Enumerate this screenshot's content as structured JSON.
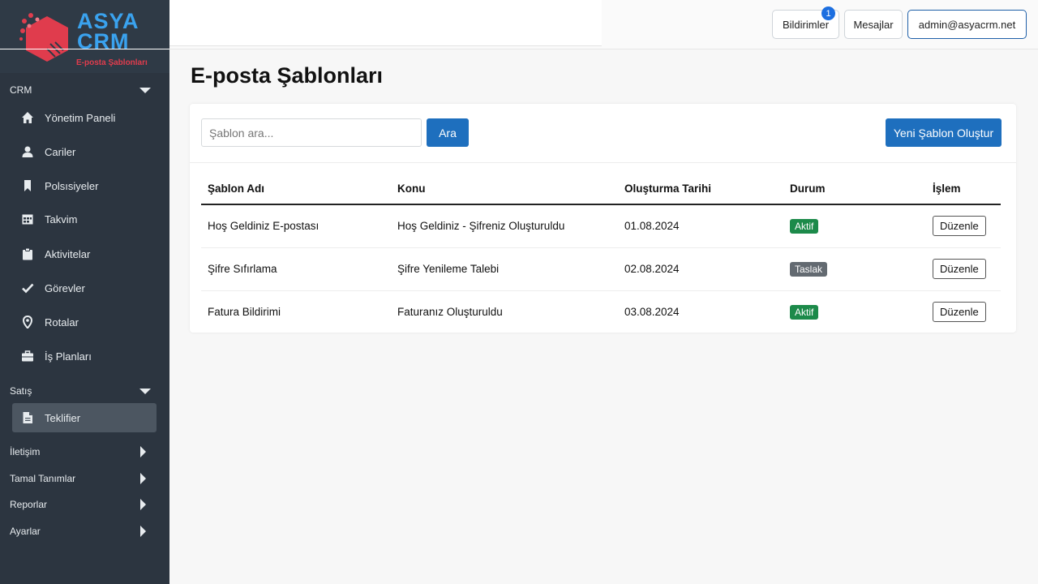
{
  "brand": {
    "name_line1": "ASYA",
    "name_line2": "CRM",
    "subtitle": "E-posta Şablonları"
  },
  "colors": {
    "sidebar_bg": "#2c3540",
    "primary": "#1e6fbe",
    "badge_active": "#1c8a4a",
    "badge_draft": "#636a71",
    "logo_red": "#e03c4d",
    "logo_blue": "#3aa2ee"
  },
  "sidebar": {
    "sections": [
      {
        "label": "CRM",
        "state": "expanded"
      },
      {
        "label": "Satış",
        "state": "expanded"
      },
      {
        "label": "İletişim",
        "state": "collapsed"
      },
      {
        "label": "Tamal Tanımlar",
        "state": "collapsed"
      },
      {
        "label": "Reporlar",
        "state": "collapsed"
      },
      {
        "label": "Ayarlar",
        "state": "collapsed"
      }
    ],
    "crm_items": [
      {
        "label": "Yönetim Paneli",
        "icon": "home-icon"
      },
      {
        "label": "Cariler",
        "icon": "user-icon"
      },
      {
        "label": "Polsısiyeler",
        "icon": "bookmark-icon"
      },
      {
        "label": "Takvim",
        "icon": "calendar-icon"
      },
      {
        "label": "Aktivitelar",
        "icon": "clipboard-icon"
      },
      {
        "label": "Görevler",
        "icon": "check-icon"
      },
      {
        "label": "Rotalar",
        "icon": "map-pin-icon"
      },
      {
        "label": "İş Planları",
        "icon": "briefcase-icon"
      }
    ],
    "sales_items": [
      {
        "label": "Teklifier",
        "icon": "document-icon",
        "active": true
      }
    ]
  },
  "topbar": {
    "notifications_label": "Bildirimler",
    "notifications_count": "1",
    "messages_label": "Mesajlar",
    "user_label": "admin@asyacrm.net"
  },
  "main": {
    "title": "E-posta Şablonları",
    "search_placeholder": "Şablon ara...",
    "search_button": "Ara",
    "new_button": "Yeni Şablon Oluştur",
    "table": {
      "headers": [
        "Şablon Adı",
        "Konu",
        "Oluşturma Tarihi",
        "Durum",
        "İşlem"
      ],
      "rows": [
        {
          "name": "Hoş Geldiniz E-postası",
          "subject": "Hoş Geldiniz - Şifreniz Oluşturuldu",
          "date": "01.08.2024",
          "status": "Aktif",
          "action": "Düzenle"
        },
        {
          "name": "Şifre Sıfırlama",
          "subject": "Şifre Yenileme Talebi",
          "date": "02.08.2024",
          "status": "Taslak",
          "action": "Düzenle"
        },
        {
          "name": "Fatura Bildirimi",
          "subject": "Faturanız Oluşturuldu",
          "date": "03.08.2024",
          "status": "Aktif",
          "action": "Düzenle"
        }
      ]
    }
  }
}
